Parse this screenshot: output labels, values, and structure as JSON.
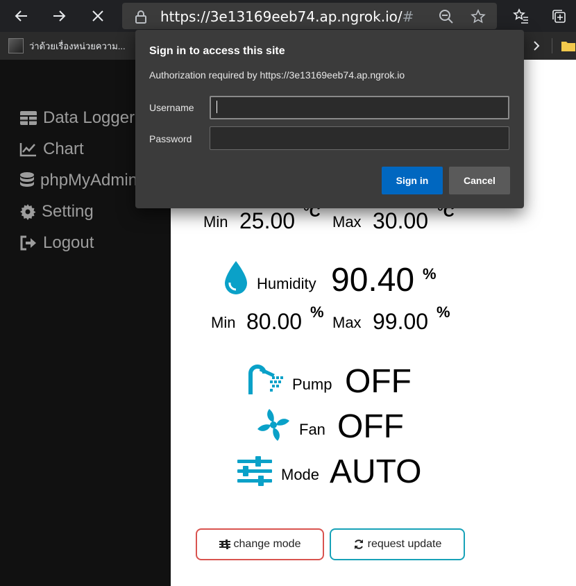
{
  "browser": {
    "url_main": "https://3e13169eeb74.ap.ngrok.io/",
    "url_hash": "#",
    "bookmark_label": "ว่าด้วยเรื่องหน่วยความ..."
  },
  "sidebar": {
    "items": [
      {
        "label": "Data Logger",
        "icon": "table-icon"
      },
      {
        "label": "Chart",
        "icon": "line-chart-icon"
      },
      {
        "label": "phpMyAdmin",
        "icon": "database-icon"
      },
      {
        "label": "Setting",
        "icon": "gear-icon"
      },
      {
        "label": "Logout",
        "icon": "sign-out-icon"
      }
    ]
  },
  "temperature": {
    "min_label": "Min",
    "min_value": "25.00",
    "max_label": "Max",
    "max_value": "30.00",
    "unit": "°C"
  },
  "humidity": {
    "label": "Humidity",
    "value": "90.40",
    "unit": "%",
    "min_label": "Min",
    "min_value": "80.00",
    "max_label": "Max",
    "max_value": "99.00"
  },
  "status": {
    "pump_label": "Pump",
    "pump_value": "OFF",
    "fan_label": "Fan",
    "fan_value": "OFF",
    "mode_label": "Mode",
    "mode_value": "AUTO"
  },
  "buttons": {
    "change_mode": "change mode",
    "request_update": "request update"
  },
  "dialog": {
    "title": "Sign in to access this site",
    "subtitle": "Authorization required by https://3e13169eeb74.ap.ngrok.io",
    "username_label": "Username",
    "password_label": "Password",
    "signin_label": "Sign in",
    "cancel_label": "Cancel"
  },
  "colors": {
    "accent_cyan": "#0aa1c8",
    "signin_blue": "#0067c0",
    "mode_button_border": "#d9534f",
    "update_button_border": "#17a2b8"
  }
}
